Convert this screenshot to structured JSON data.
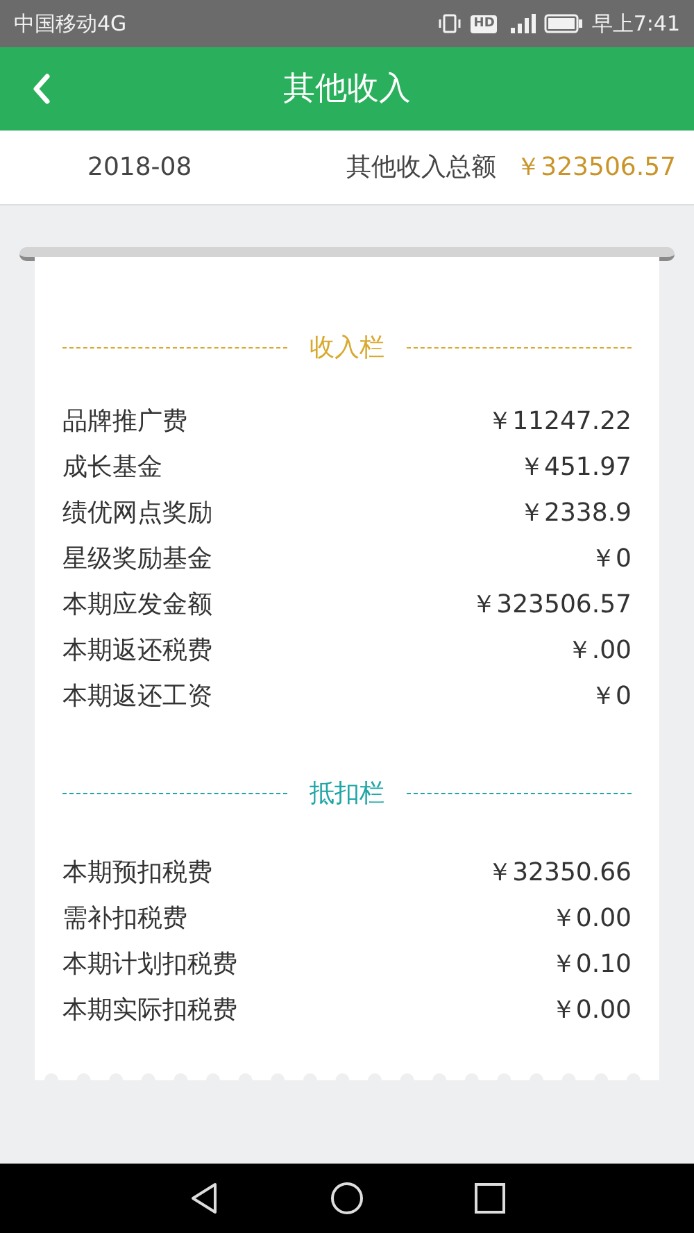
{
  "status_bar": {
    "carrier": "中国移动4G",
    "hd_badge": "HD",
    "time": "早上7:41"
  },
  "header": {
    "title": "其他收入"
  },
  "summary": {
    "month": "2018-08",
    "total_label": "其他收入总额",
    "total_value": "￥323506.57"
  },
  "sections": [
    {
      "title": "收入栏",
      "color": "#d9a82e",
      "rows": [
        {
          "label": "品牌推广费",
          "value": "￥11247.22"
        },
        {
          "label": "成长基金",
          "value": "￥451.97"
        },
        {
          "label": "绩优网点奖励",
          "value": "￥2338.9"
        },
        {
          "label": "星级奖励基金",
          "value": "￥0"
        },
        {
          "label": "本期应发金额",
          "value": "￥323506.57"
        },
        {
          "label": "本期返还税费",
          "value": "￥.00"
        },
        {
          "label": "本期返还工资",
          "value": "￥0"
        }
      ]
    },
    {
      "title": "抵扣栏",
      "color": "#1fa6a6",
      "rows": [
        {
          "label": "本期预扣税费",
          "value": "￥32350.66"
        },
        {
          "label": "需补扣税费",
          "value": "￥0.00"
        },
        {
          "label": "本期计划扣税费",
          "value": "￥0.10"
        },
        {
          "label": "本期实际扣税费",
          "value": "￥0.00"
        }
      ]
    }
  ]
}
